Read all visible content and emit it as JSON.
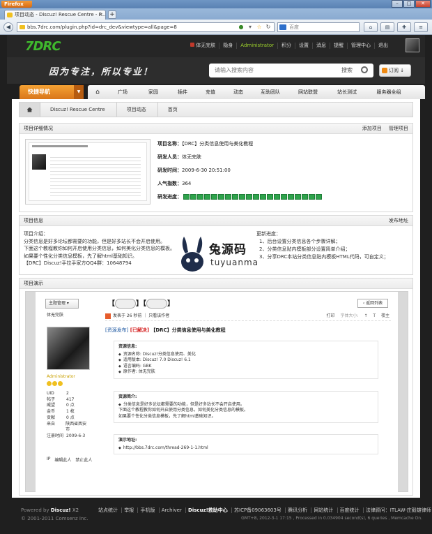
{
  "browser": {
    "app_name": "Firefox",
    "tab_title": "项目动态 - Discuz! Rescue Centre - P...",
    "new_tab": "+",
    "url": "bbs.7drc.com/plugin.php?id=drc_dev&viewtype=all&page=8",
    "search_placeholder": "百度"
  },
  "header": {
    "logo": "7DRC",
    "user_nav": [
      "体无完肤",
      "隐身",
      "Administrator",
      "积分",
      "设置",
      "消息",
      "提醒",
      "管理中心",
      "退出"
    ],
    "slogan": "因为专注，所以专业！",
    "search_placeholder": "请输入搜索内容",
    "search_type": "搜索",
    "rss_label": "订阅"
  },
  "nav": {
    "quick_nav": "快捷导航",
    "items": [
      "广场",
      "家园",
      "插件",
      "充值",
      "动态",
      "互助团队",
      "网站联盟",
      "站长测试",
      "服务器全组"
    ]
  },
  "breadcrumb": [
    "Discuz! Rescue Centre",
    "项目动态",
    "首页"
  ],
  "project": {
    "section_title": "项目详细情况",
    "actions": [
      "添加项目",
      "管理项目"
    ],
    "name_label": "项目名称：",
    "name_value": "【DRC】分类信息使用与美化教程",
    "dev_label": "研发人员：",
    "dev_value": "体无完肤",
    "time_label": "研发时间：",
    "time_value": "2009-6-30 20:51:00",
    "pop_label": "人气指数：",
    "pop_value": "364",
    "progress_label": "研发进度：",
    "progress_segments": 20
  },
  "info": {
    "section_title": "项目信息",
    "action": "发布地址",
    "desc_title": "项目介绍：",
    "desc_lines": [
      "分类信息是好多论坛都需要的功能，但是好多站长不会开启使用。",
      "下面这个教程教你如何开启使用分类信息，如何美化分类信息的模板。",
      "如果要个性化分类信息模板，先了解html基础知识。",
      "【DRC】Discuz!手拉手家方QQ4群：10648794"
    ],
    "update_title": "更新进度：",
    "update_lines": [
      "1、后台设置分类信息各个步骤详解；",
      "2、分类信息贴内模板部分设置简单介绍；",
      "3、分享DRC本站分类信息贴内模板HTML代码，可自定义；"
    ],
    "watermark_cn": "兔源码",
    "watermark_en": "tuyuanma"
  },
  "demo": {
    "section_title": "项目演示",
    "topic_btn": "主题管理 ▾",
    "back_btn": "‹ 返回列表",
    "title_prefix": "【",
    "title_mid": "】【",
    "title_suffix": "】",
    "author": "体无完肤",
    "role": "Administrator",
    "stats": [
      {
        "k": "UID",
        "v": "2"
      },
      {
        "k": "帖子",
        "v": "417"
      },
      {
        "k": "威望",
        "v": "0 点"
      },
      {
        "k": "金币",
        "v": "1 枚"
      },
      {
        "k": "贡献",
        "v": "0 点"
      },
      {
        "k": "来自",
        "v": "陕西省西安市"
      },
      {
        "k": "注册时间",
        "v": "2009-6-3"
      }
    ],
    "user_actions": [
      "IP",
      "编辑此人",
      "禁止此人"
    ],
    "post_meta": "发表于 26 秒前 ｜ 只看该作者",
    "tools": [
      "打印",
      "字体大小:",
      "↑",
      "T",
      "楼主"
    ],
    "post_tag": "[资源发布]",
    "post_solved": "[已解决]",
    "post_title": "【DRC】分类信息使用与美化教程",
    "res_head": "资源信息:",
    "res_items": [
      "资源名称: Discuz!分类信息使用、美化",
      "适用版本: Discuz! 7.0 Discuz! 6.1",
      "语言编码: GBK",
      "原作者: 体无完肤"
    ],
    "intro_head": "资源简介:",
    "intro_lines": [
      "分类信息是好多论坛都需要的功能，但是好多站长不会开启使用。",
      "下面这个教程教你如何开启使用分类信息，如何美化分类信息的模板。",
      "如果要个性化分类信息模板，先了解html基础知识。"
    ],
    "addr_head": "演示地址:",
    "addr_link": "http://bbs.7drc.com/thread-269-1-1.html"
  },
  "footer": {
    "powered": "Powered by",
    "brand": "Discuz!",
    "ver": "X2",
    "copyright": "© 2001-2011 Comsenz Inc.",
    "links": [
      "站点统计",
      "举报",
      "手机版",
      "Archiver",
      "Discuz!救助中心",
      "苏ICP备09063603号",
      "腾讯分析",
      "网站统计",
      "百度统计",
      "法律顾问：ITLAW-庄毅雄律师"
    ],
    "runtime": "GMT+8, 2012-3-1 17:15 , Processed in 0.034904 second(s), 6 queries , Memcache On."
  }
}
